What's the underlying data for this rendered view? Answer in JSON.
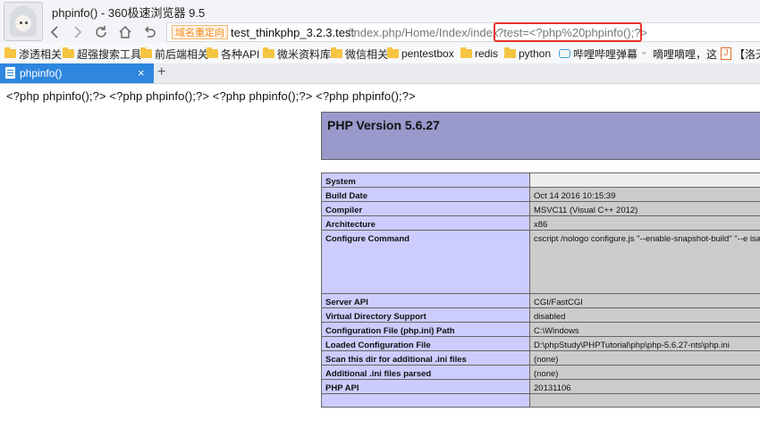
{
  "window": {
    "title": "phpinfo() - 360极速浏览器 9.5"
  },
  "nav": {
    "back_icon": "chevron-left-icon",
    "forward_icon": "chevron-right-icon",
    "reload_icon": "reload-icon",
    "home_icon": "home-icon",
    "undo_icon": "undo-icon"
  },
  "address_bar": {
    "redirect_tag": "域名重定向",
    "url_host": "test_thinkphp_3.2.3.test",
    "url_path": "/index.php/Home/Index/index",
    "url_query": "?test=<?php%20phpinfo();?>",
    "highlight_color": "#e8322b"
  },
  "bookmarks": [
    {
      "label": "渗透相关",
      "icon": "folder-icon"
    },
    {
      "label": "超强搜索工具",
      "icon": "folder-icon"
    },
    {
      "label": "前后端相关",
      "icon": "folder-icon"
    },
    {
      "label": "各种API",
      "icon": "folder-icon"
    },
    {
      "label": "微米资料库",
      "icon": "folder-icon"
    },
    {
      "label": "微信相关",
      "icon": "folder-icon"
    },
    {
      "label": "pentestbox",
      "icon": "folder-icon"
    },
    {
      "label": "redis",
      "icon": "folder-icon"
    },
    {
      "label": "python",
      "icon": "folder-icon"
    },
    {
      "label": "哔哩哔哩弹幕",
      "icon": "bilibili-icon"
    },
    {
      "label": "嘀哩嘀哩，这",
      "icon": "smile-icon"
    },
    {
      "label": "【洛天",
      "icon": "j-icon"
    }
  ],
  "tabs": [
    {
      "label": "phpinfo()",
      "active": true,
      "close": "×"
    }
  ],
  "new_tab": "+",
  "page": {
    "echo_text": "<?php phpinfo();?> <?php phpinfo();?> <?php phpinfo();?> <?php phpinfo();?>",
    "php_version_title": "PHP Version 5.6.27",
    "rows": [
      {
        "key": "System",
        "value": ""
      },
      {
        "key": "Build Date",
        "value": "Oct 14 2016 10:15:39"
      },
      {
        "key": "Compiler",
        "value": "MSVC11 (Visual C++ 2012)"
      },
      {
        "key": "Architecture",
        "value": "x86"
      },
      {
        "key": "Configure Command",
        "value": "cscript /nologo configure.js \"--enable-snapshot-build\" \"--e\nisapi\" \"--disable-nsapi\" \"--without-mssql\" \"--without-pdo-m\noci=c:\\php-sdk\\oracle\\x86\\instantclient_12_1\\sdk,shared\" \"\nsdk\\oracle\\x86\\instantclient_12_1\\sdk,shared\" \"--with-ench\n\"--enable-com-dotnet=shared\" \"--with-mcrypt=static\" \"--w"
      },
      {
        "key": "Server API",
        "value": "CGI/FastCGI"
      },
      {
        "key": "Virtual Directory Support",
        "value": "disabled"
      },
      {
        "key": "Configuration File (php.ini) Path",
        "value": "C:\\Windows"
      },
      {
        "key": "Loaded Configuration File",
        "value": "D:\\phpStudy\\PHPTutorial\\php\\php-5.6.27-nts\\php.ini"
      },
      {
        "key": "Scan this dir for additional .ini files",
        "value": "(none)"
      },
      {
        "key": "Additional .ini files parsed",
        "value": "(none)"
      },
      {
        "key": "PHP API",
        "value": "20131106"
      },
      {
        "key": "",
        "value": ""
      }
    ]
  },
  "colors": {
    "php_header": "#9999cc",
    "php_key_cell": "#ccccff",
    "php_value_cell": "#cccccc",
    "tab_active": "#2e86de",
    "redirect_tag": "#f08b1e"
  }
}
